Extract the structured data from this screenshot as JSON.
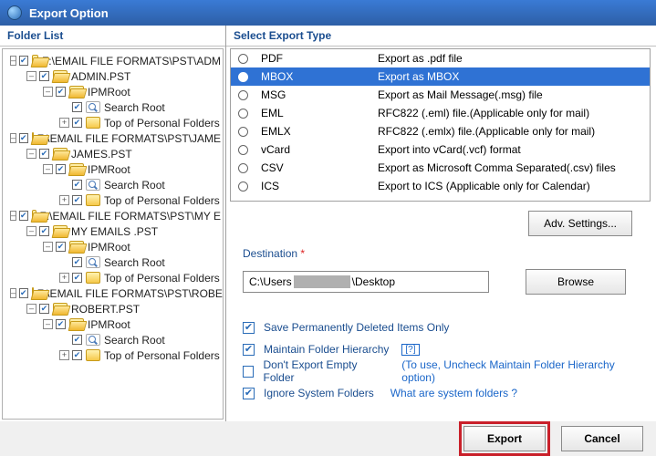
{
  "window": {
    "title": "Export Option"
  },
  "left_panel": {
    "header": "Folder List"
  },
  "tree": {
    "roots": [
      {
        "label": "F:\\EMAIL FILE FORMATS\\PST\\ADM",
        "children": [
          {
            "label": "ADMIN.PST",
            "children": [
              {
                "label": "IPMRoot",
                "children": [
                  {
                    "label": "Search Root",
                    "icon": "search"
                  },
                  {
                    "label": "Top of Personal Folders",
                    "icon": "folder"
                  }
                ]
              }
            ]
          }
        ]
      },
      {
        "label": "F:\\EMAIL FILE FORMATS\\PST\\JAME",
        "children": [
          {
            "label": "JAMES.PST",
            "children": [
              {
                "label": "IPMRoot",
                "children": [
                  {
                    "label": "Search Root",
                    "icon": "search"
                  },
                  {
                    "label": "Top of Personal Folders",
                    "icon": "folder"
                  }
                ]
              }
            ]
          }
        ]
      },
      {
        "label": "F:\\EMAIL FILE FORMATS\\PST\\MY E",
        "children": [
          {
            "label": "MY EMAILS .PST",
            "children": [
              {
                "label": "IPMRoot",
                "children": [
                  {
                    "label": "Search Root",
                    "icon": "search"
                  },
                  {
                    "label": "Top of Personal Folders",
                    "icon": "folder"
                  }
                ]
              }
            ]
          }
        ]
      },
      {
        "label": "F:\\EMAIL FILE FORMATS\\PST\\ROBE",
        "children": [
          {
            "label": "ROBERT.PST",
            "children": [
              {
                "label": "IPMRoot",
                "children": [
                  {
                    "label": "Search Root",
                    "icon": "search"
                  },
                  {
                    "label": "Top of Personal Folders",
                    "icon": "folder"
                  }
                ]
              }
            ]
          }
        ]
      }
    ]
  },
  "right_panel": {
    "header": "Select Export Type"
  },
  "export_types": [
    {
      "code": "PDF",
      "desc": "Export as .pdf file",
      "selected": false
    },
    {
      "code": "MBOX",
      "desc": "Export as MBOX",
      "selected": true
    },
    {
      "code": "MSG",
      "desc": "Export as Mail Message(.msg) file",
      "selected": false
    },
    {
      "code": "EML",
      "desc": "RFC822 (.eml) file.(Applicable only for mail)",
      "selected": false
    },
    {
      "code": "EMLX",
      "desc": "RFC822 (.emlx) file.(Applicable only for mail)",
      "selected": false
    },
    {
      "code": "vCard",
      "desc": "Export into vCard(.vcf) format",
      "selected": false
    },
    {
      "code": "CSV",
      "desc": "Export as Microsoft Comma Separated(.csv) files",
      "selected": false
    },
    {
      "code": "ICS",
      "desc": "Export to ICS (Applicable only for Calendar)",
      "selected": false
    }
  ],
  "buttons": {
    "adv_settings": "Adv. Settings...",
    "browse": "Browse",
    "export": "Export",
    "cancel": "Cancel"
  },
  "destination": {
    "label": "Destination",
    "required": "*",
    "prefix": "C:\\Users",
    "suffix": "\\Desktop"
  },
  "options": {
    "save_deleted": {
      "label": "Save Permanently Deleted Items Only",
      "checked": true
    },
    "maintain_hierarchy": {
      "label": "Maintain Folder Hierarchy",
      "checked": true,
      "help": "[?]"
    },
    "dont_export_empty": {
      "label": "Don't Export Empty Folder",
      "checked": false,
      "hint": "(To use, Uncheck Maintain Folder Hierarchy option)"
    },
    "ignore_system": {
      "label": "Ignore System Folders",
      "checked": true,
      "help": "What are system folders ?"
    }
  }
}
